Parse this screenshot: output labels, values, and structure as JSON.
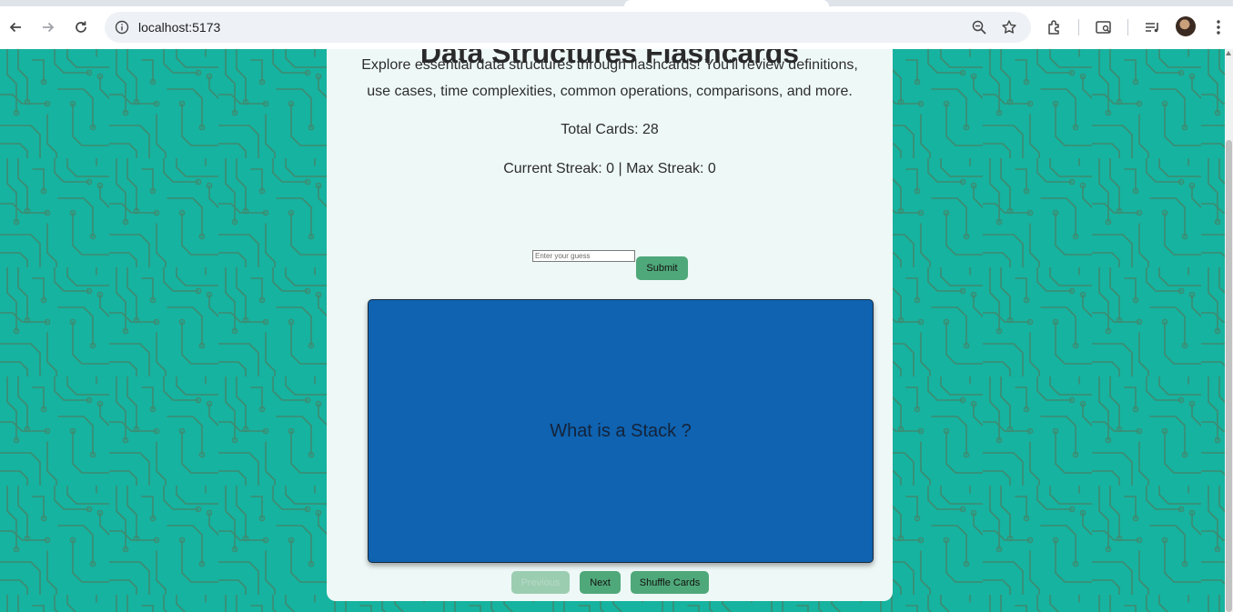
{
  "browser": {
    "url": "localhost:5173"
  },
  "page": {
    "title": "Data Structures Flashcards",
    "description": "Explore essential data structures through flashcards! You'll review definitions, use cases, time complexities, common operations, comparisons, and more.",
    "total_cards": "Total Cards: 28",
    "streak": "Current Streak: 0 | Max Streak: 0",
    "guess_placeholder": "Enter your guess",
    "submit_label": "Submit",
    "card_question": "What is a Stack ?",
    "previous_label": "Previous",
    "next_label": "Next",
    "shuffle_label": "Shuffle Cards"
  },
  "colors": {
    "background": "#16b3a0",
    "circuit_lines": "#3e8a70",
    "panel": "#eef8f7",
    "card": "#0f63b0",
    "button": "#4fa879",
    "button_disabled": "#9bcdb1"
  }
}
